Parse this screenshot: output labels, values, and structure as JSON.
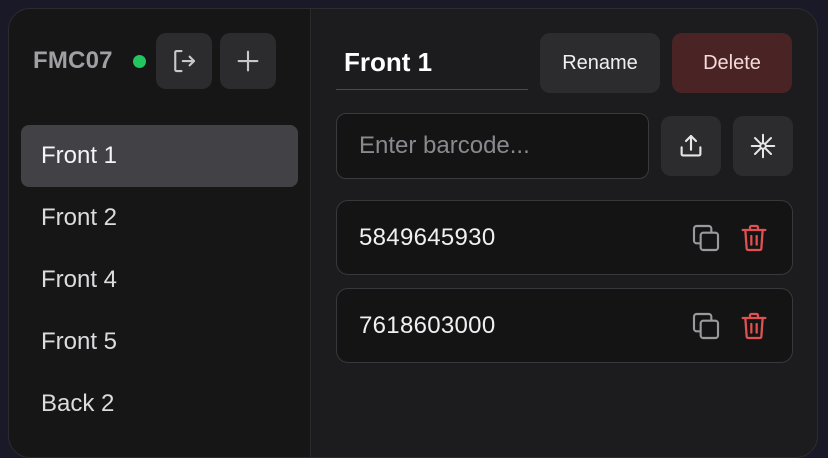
{
  "sidebar": {
    "device_name": "FMC07",
    "status_color": "#22c55e",
    "logout_icon": "logout-icon",
    "add_icon": "plus-icon",
    "items": [
      {
        "label": "Front 1",
        "active": true
      },
      {
        "label": "Front 2",
        "active": false
      },
      {
        "label": "Front 4",
        "active": false
      },
      {
        "label": "Front 5",
        "active": false
      },
      {
        "label": "Back 2",
        "active": false
      }
    ]
  },
  "main": {
    "title_value": "Front 1",
    "rename_label": "Rename",
    "delete_label": "Delete",
    "barcode_placeholder": "Enter barcode...",
    "upload_icon": "upload-icon",
    "scan_icon": "asterisk-icon",
    "codes": [
      {
        "value": "5849645930"
      },
      {
        "value": "7618603000"
      }
    ]
  },
  "colors": {
    "accent_green": "#22c55e",
    "delete_red": "#e05252",
    "delete_button_bg": "#4a2325"
  }
}
